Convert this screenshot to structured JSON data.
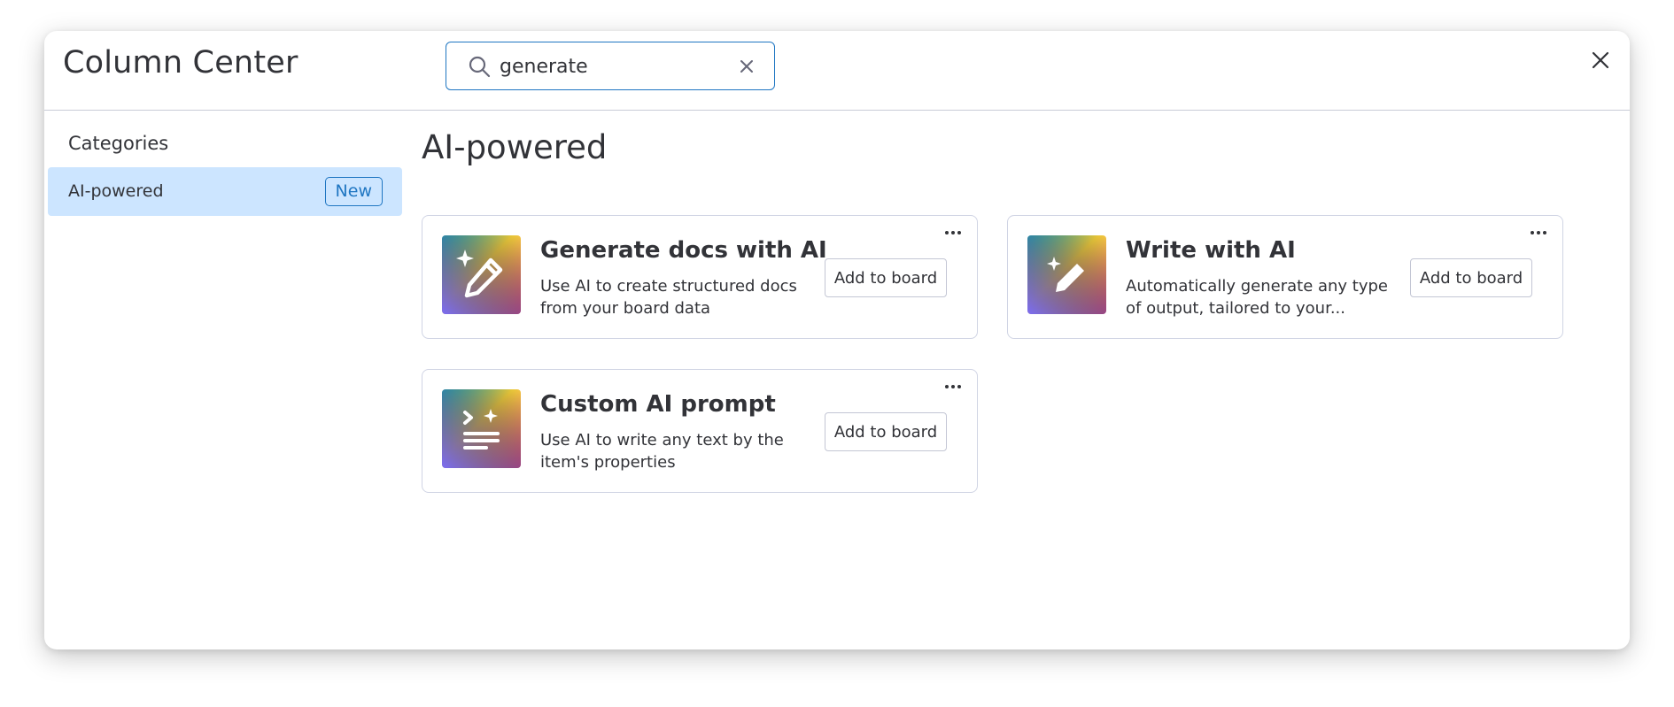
{
  "header": {
    "title": "Column Center",
    "search": {
      "value": "generate",
      "placeholder": ""
    }
  },
  "sidebar": {
    "heading": "Categories",
    "items": [
      {
        "label": "AI-powered",
        "badge": "New",
        "selected": true
      }
    ]
  },
  "main": {
    "section_title": "AI-powered",
    "cards": [
      {
        "title": "Generate docs with AI",
        "description": "Use AI to create structured docs from your board data",
        "button_label": "Add to board",
        "icon": "sparkle-pencil-icon"
      },
      {
        "title": "Write with AI",
        "description": "Automatically generate any type of output, tailored to your...",
        "button_label": "Add to board",
        "icon": "sparkle-pen-icon"
      },
      {
        "title": "Custom AI prompt",
        "description": "Use AI to write any text by the item's properties",
        "button_label": "Add to board",
        "icon": "prompt-lines-icon"
      }
    ]
  },
  "colors": {
    "accent": "#1f76c2",
    "selected_bg": "#cce5ff",
    "text": "#323338",
    "border": "#d0d4e4"
  }
}
